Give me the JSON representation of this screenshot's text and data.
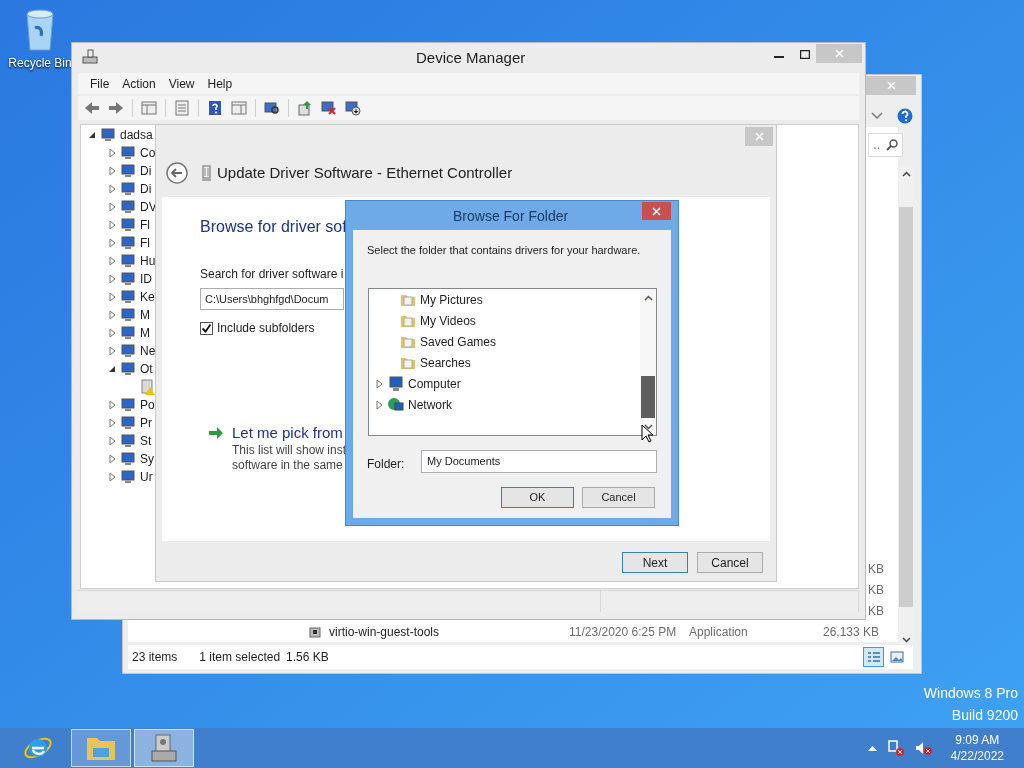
{
  "desktop": {
    "icons": [
      {
        "label": "Recycle Bin"
      }
    ],
    "edition": [
      "Windows 8 Pro",
      "Build 9200"
    ]
  },
  "explorer": {
    "search_text": "..",
    "size_fragments": [
      "KB",
      "KB",
      "KB"
    ],
    "row": {
      "name": "virtio-win-guest-tools",
      "date": "11/23/2020 6:25 PM",
      "type": "Application",
      "size": "26,133 KB"
    },
    "status_bar": {
      "count": "23 items",
      "selection": "1 item selected",
      "size": "1.56 KB"
    },
    "views": [
      {
        "kind": "details",
        "selected": true
      },
      {
        "kind": "thumbnails",
        "selected": false
      }
    ]
  },
  "device_manager": {
    "title": "Device Manager",
    "menu": [
      "File",
      "Action",
      "View",
      "Help"
    ],
    "tree": {
      "label": "dadsa",
      "expanded": true,
      "children": [
        {
          "label": "Co",
          "expanded": false
        },
        {
          "label": "Di",
          "expanded": false
        },
        {
          "label": "Di",
          "expanded": false
        },
        {
          "label": "DV",
          "expanded": false
        },
        {
          "label": "Fl",
          "expanded": false
        },
        {
          "label": "Fl",
          "expanded": false
        },
        {
          "label": "Hu",
          "expanded": false
        },
        {
          "label": "ID",
          "expanded": false
        },
        {
          "label": "Ke",
          "expanded": false
        },
        {
          "label": "M",
          "expanded": false
        },
        {
          "label": "M",
          "expanded": false
        },
        {
          "label": "Ne",
          "expanded": false
        },
        {
          "label": "Ot",
          "expanded": true,
          "children": [
            {
              "warning": true
            }
          ]
        },
        {
          "label": "Po",
          "expanded": false
        },
        {
          "label": "Pr",
          "expanded": false
        },
        {
          "label": "St",
          "expanded": false
        },
        {
          "label": "Sy",
          "expanded": false
        },
        {
          "label": "Ur",
          "expanded": false
        }
      ]
    }
  },
  "update_dialog": {
    "title": "Update Driver Software - Ethernet Controller",
    "heading": "Browse for driver sof",
    "search_label": "Search for driver software i",
    "path": "C:\\Users\\bhghfgd\\Docum",
    "include_subfolders": {
      "label": "Include subfolders",
      "checked": true
    },
    "option": {
      "title": "Let me pick from",
      "description": [
        "This list will show inst",
        "software in the same"
      ]
    },
    "buttons": [
      "Next",
      "Cancel"
    ]
  },
  "browse_dialog": {
    "title": "Browse For Folder",
    "instruction": "Select the folder that contains drivers for your hardware.",
    "tree": [
      {
        "kind": "folder-group",
        "children": [
          {
            "label": "My Pictures"
          },
          {
            "label": "My Videos"
          },
          {
            "label": "Saved Games"
          },
          {
            "label": "Searches"
          }
        ]
      },
      {
        "kind": "computer",
        "label": "Computer",
        "expanded": false
      },
      {
        "kind": "network",
        "label": "Network",
        "expanded": false
      }
    ],
    "folder_label": "Folder:",
    "folder_value": "My Documents",
    "buttons": [
      "OK",
      "Cancel"
    ]
  },
  "taskbar": {
    "buttons": [
      {
        "kind": "browser",
        "open": false,
        "selected": false
      },
      {
        "kind": "folder",
        "open": true,
        "selected": false
      },
      {
        "kind": "device-manager",
        "open": true,
        "selected": true
      }
    ],
    "tray": {
      "time": "9:09 AM",
      "date": "4/22/2022"
    }
  }
}
